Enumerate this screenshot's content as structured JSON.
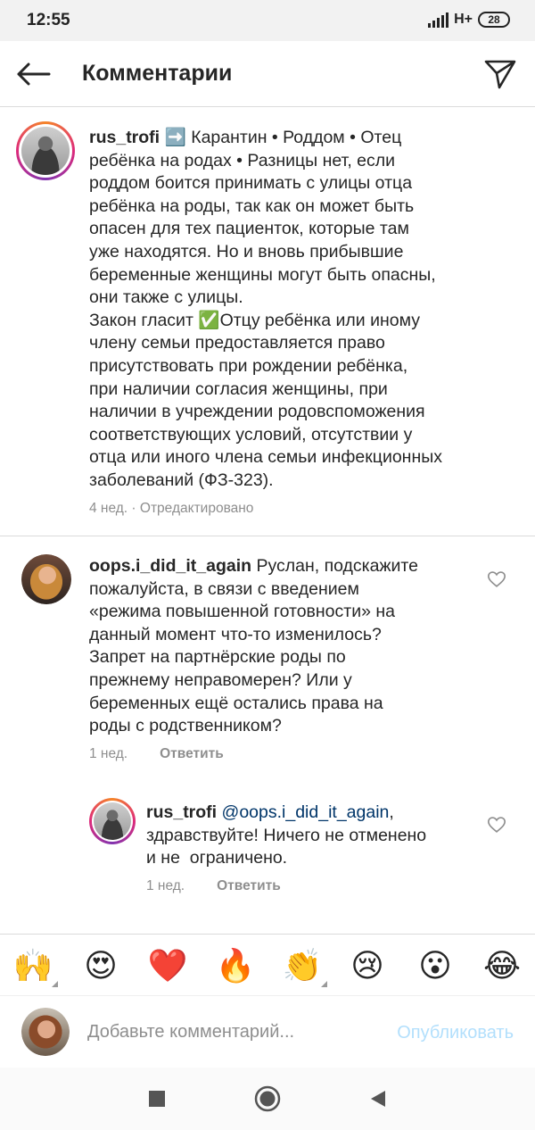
{
  "status_bar": {
    "time": "12:55",
    "network": "H+",
    "battery": "28"
  },
  "header": {
    "title": "Комментарии"
  },
  "caption": {
    "username": "rus_trofi",
    "text": " ➡️ Карантин • Роддом • Отец\nребёнка на родах • Разницы нет, если\nроддом боится принимать с улицы отца\nребёнка на роды, так как он может быть\nопасен для тех пациенток, которые там\nуже находятся. Но и вновь прибывшие\nбеременные женщины могут быть опасны,\nони также с улицы.\nЗакон гласит ✅Отцу ребёнка или иному\nчлену семьи предоставляется право\nприсутствовать при рождении ребёнка,\nпри наличии согласия женщины, при\nналичии в учреждении родовспоможения\nсоответствующих условий, отсутствии у\nотца или иного члена семьи инфекционных\nзаболеваний (ФЗ-323).",
    "meta": "4 нед. · Отредактировано"
  },
  "comments": [
    {
      "username": "oops.i_did_it_again",
      "text": " Руслан, подскажите\nпожалуйста, в связи с введением\n«режима повышенной готовности» на\nданный момент что-то изменилось?\nЗапрет на партнёрские роды по\nпрежнему неправомерен? Или у\nбеременных ещё остались права на\nроды с родственником?",
      "time": "1 нед.",
      "reply_label": "Ответить"
    },
    {
      "username": "rus_trofi",
      "mention": "@oops.i_did_it_again",
      "text": ",\nздравствуйте! Ничего не отменено\nи не  ограничено.",
      "time": "1 нед.",
      "reply_label": "Ответить"
    }
  ],
  "emoji_bar": [
    "🙌",
    "😍",
    "❤️",
    "🔥",
    "👏",
    "😢",
    "😮",
    "😂"
  ],
  "input": {
    "placeholder": "Добавьте комментарий...",
    "publish_label": "Опубликовать"
  },
  "colors": {
    "accent_disabled": "#b2dffc",
    "mention": "#003569",
    "meta": "#8e8e8e",
    "text": "#262626"
  }
}
